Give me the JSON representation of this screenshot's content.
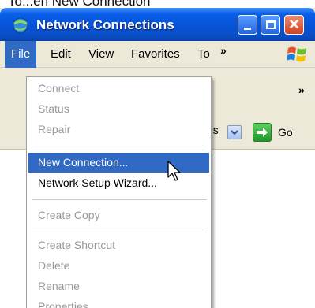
{
  "caption": "To...en New Connection",
  "window": {
    "title": "Network Connections",
    "buttons": {
      "minimize": "minimize",
      "maximize": "maximize",
      "close": "✕"
    }
  },
  "menubar": {
    "items": [
      {
        "label": "File"
      },
      {
        "label": "Edit"
      },
      {
        "label": "View"
      },
      {
        "label": "Favorites"
      },
      {
        "label": "To"
      }
    ],
    "overflow": "»"
  },
  "toolbar": {
    "overflow": "»"
  },
  "addressbar": {
    "partial_text": "ns",
    "go_label": "Go"
  },
  "file_menu": {
    "groups": [
      [
        {
          "label": "Connect",
          "enabled": false
        },
        {
          "label": "Status",
          "enabled": false
        },
        {
          "label": "Repair",
          "enabled": false
        }
      ],
      [
        {
          "label": "New Connection...",
          "enabled": true,
          "highlighted": true
        },
        {
          "label": "Network Setup Wizard...",
          "enabled": true
        }
      ],
      [
        {
          "label": "Create Copy",
          "enabled": false
        }
      ],
      [
        {
          "label": "Create Shortcut",
          "enabled": false
        },
        {
          "label": "Delete",
          "enabled": false
        },
        {
          "label": "Rename",
          "enabled": false
        },
        {
          "label": "Properties",
          "enabled": false
        }
      ]
    ]
  },
  "colors": {
    "title_blue": "#0653d8",
    "menu_highlight": "#316ac5",
    "disabled_text": "#9a9a9a",
    "chrome": "#ece9d8",
    "close_red": "#d2401d",
    "go_green": "#1b9a2a"
  },
  "icons": {
    "app": "network-connections-icon",
    "logo": "windows-logo-icon",
    "cursor": "mouse-pointer-icon",
    "go": "go-arrow-icon",
    "dropdown": "chevron-down-icon"
  }
}
